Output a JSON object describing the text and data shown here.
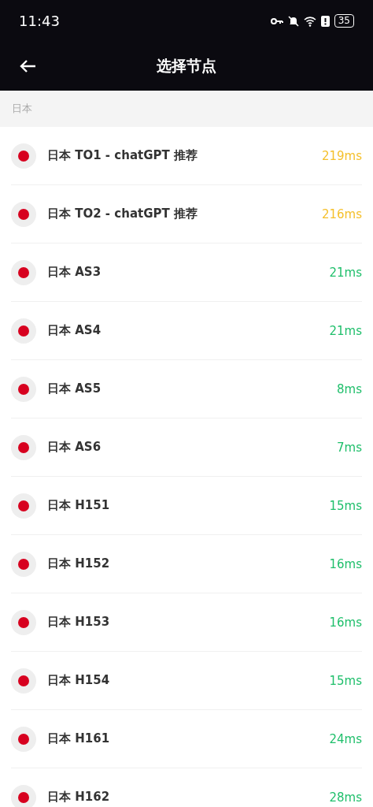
{
  "status_bar": {
    "time": "11:43",
    "battery": "35"
  },
  "app_bar": {
    "title": "选择节点"
  },
  "section": {
    "title": "日本"
  },
  "nodes": [
    {
      "name": "日本 TO1 - chatGPT 推荐",
      "latency": "219ms",
      "color": "#f5c02c"
    },
    {
      "name": "日本 TO2 - chatGPT 推荐",
      "latency": "216ms",
      "color": "#f5c02c"
    },
    {
      "name": "日本 AS3",
      "latency": "21ms",
      "color": "#1fbf6b"
    },
    {
      "name": "日本 AS4",
      "latency": "21ms",
      "color": "#1fbf6b"
    },
    {
      "name": "日本 AS5",
      "latency": "8ms",
      "color": "#1fbf6b"
    },
    {
      "name": "日本 AS6",
      "latency": "7ms",
      "color": "#1fbf6b"
    },
    {
      "name": "日本 H151",
      "latency": "15ms",
      "color": "#1fbf6b"
    },
    {
      "name": "日本 H152",
      "latency": "16ms",
      "color": "#1fbf6b"
    },
    {
      "name": "日本 H153",
      "latency": "16ms",
      "color": "#1fbf6b"
    },
    {
      "name": "日本 H154",
      "latency": "15ms",
      "color": "#1fbf6b"
    },
    {
      "name": "日本 H161",
      "latency": "24ms",
      "color": "#1fbf6b"
    },
    {
      "name": "日本 H162",
      "latency": "28ms",
      "color": "#1fbf6b"
    }
  ]
}
